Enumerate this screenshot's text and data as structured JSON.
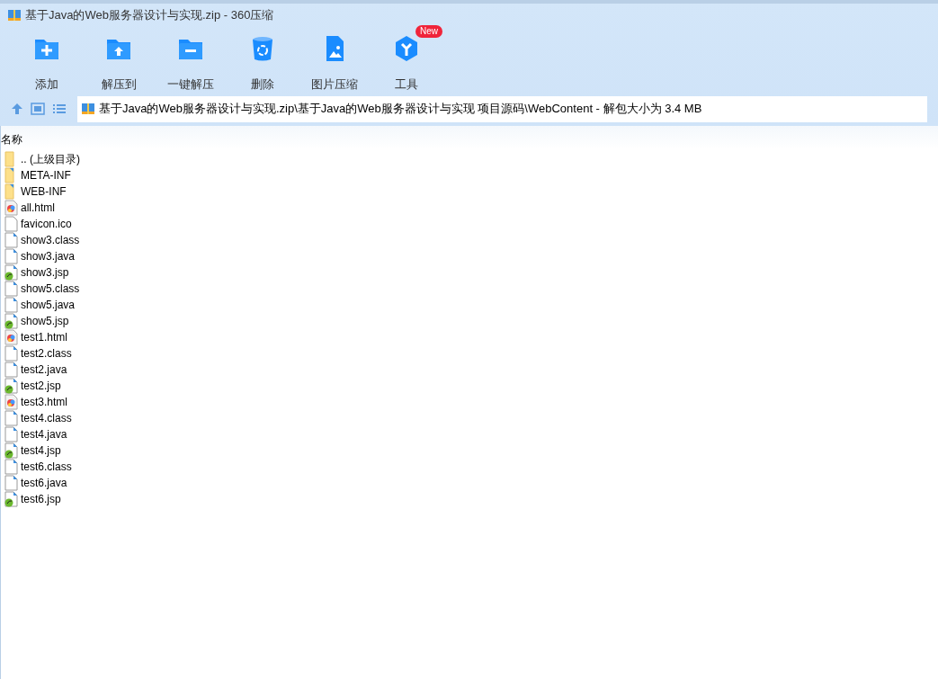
{
  "window": {
    "title": "基于Java的Web服务器设计与实现.zip - 360压缩"
  },
  "toolbar": [
    {
      "kind": "add",
      "label": "添加"
    },
    {
      "kind": "extract",
      "label": "解压到"
    },
    {
      "kind": "oneclick",
      "label": "一键解压"
    },
    {
      "kind": "delete",
      "label": "删除"
    },
    {
      "kind": "image",
      "label": "图片压缩"
    },
    {
      "kind": "tools",
      "label": "工具",
      "badge": "New"
    }
  ],
  "address": {
    "path": "基于Java的Web服务器设计与实现.zip\\基于Java的Web服务器设计与实现 项目源码\\WebContent - 解包大小为 3.4 MB"
  },
  "list": {
    "columns": [
      "名称"
    ],
    "rows": [
      {
        "kind": "parent",
        "name": ".. (上级目录)"
      },
      {
        "kind": "folder",
        "name": "META-INF"
      },
      {
        "kind": "folder",
        "name": "WEB-INF"
      },
      {
        "kind": "html",
        "name": "all.html"
      },
      {
        "kind": "plain",
        "name": "favicon.ico"
      },
      {
        "kind": "doc",
        "name": "show3.class"
      },
      {
        "kind": "doc",
        "name": "show3.java"
      },
      {
        "kind": "jsp",
        "name": "show3.jsp"
      },
      {
        "kind": "doc",
        "name": "show5.class"
      },
      {
        "kind": "doc",
        "name": "show5.java"
      },
      {
        "kind": "jsp",
        "name": "show5.jsp"
      },
      {
        "kind": "html",
        "name": "test1.html"
      },
      {
        "kind": "doc",
        "name": "test2.class"
      },
      {
        "kind": "doc",
        "name": "test2.java"
      },
      {
        "kind": "jsp",
        "name": "test2.jsp"
      },
      {
        "kind": "html",
        "name": "test3.html"
      },
      {
        "kind": "doc",
        "name": "test4.class"
      },
      {
        "kind": "doc",
        "name": "test4.java"
      },
      {
        "kind": "jsp",
        "name": "test4.jsp"
      },
      {
        "kind": "doc",
        "name": "test6.class"
      },
      {
        "kind": "doc",
        "name": "test6.java"
      },
      {
        "kind": "jsp",
        "name": "test6.jsp"
      }
    ]
  }
}
